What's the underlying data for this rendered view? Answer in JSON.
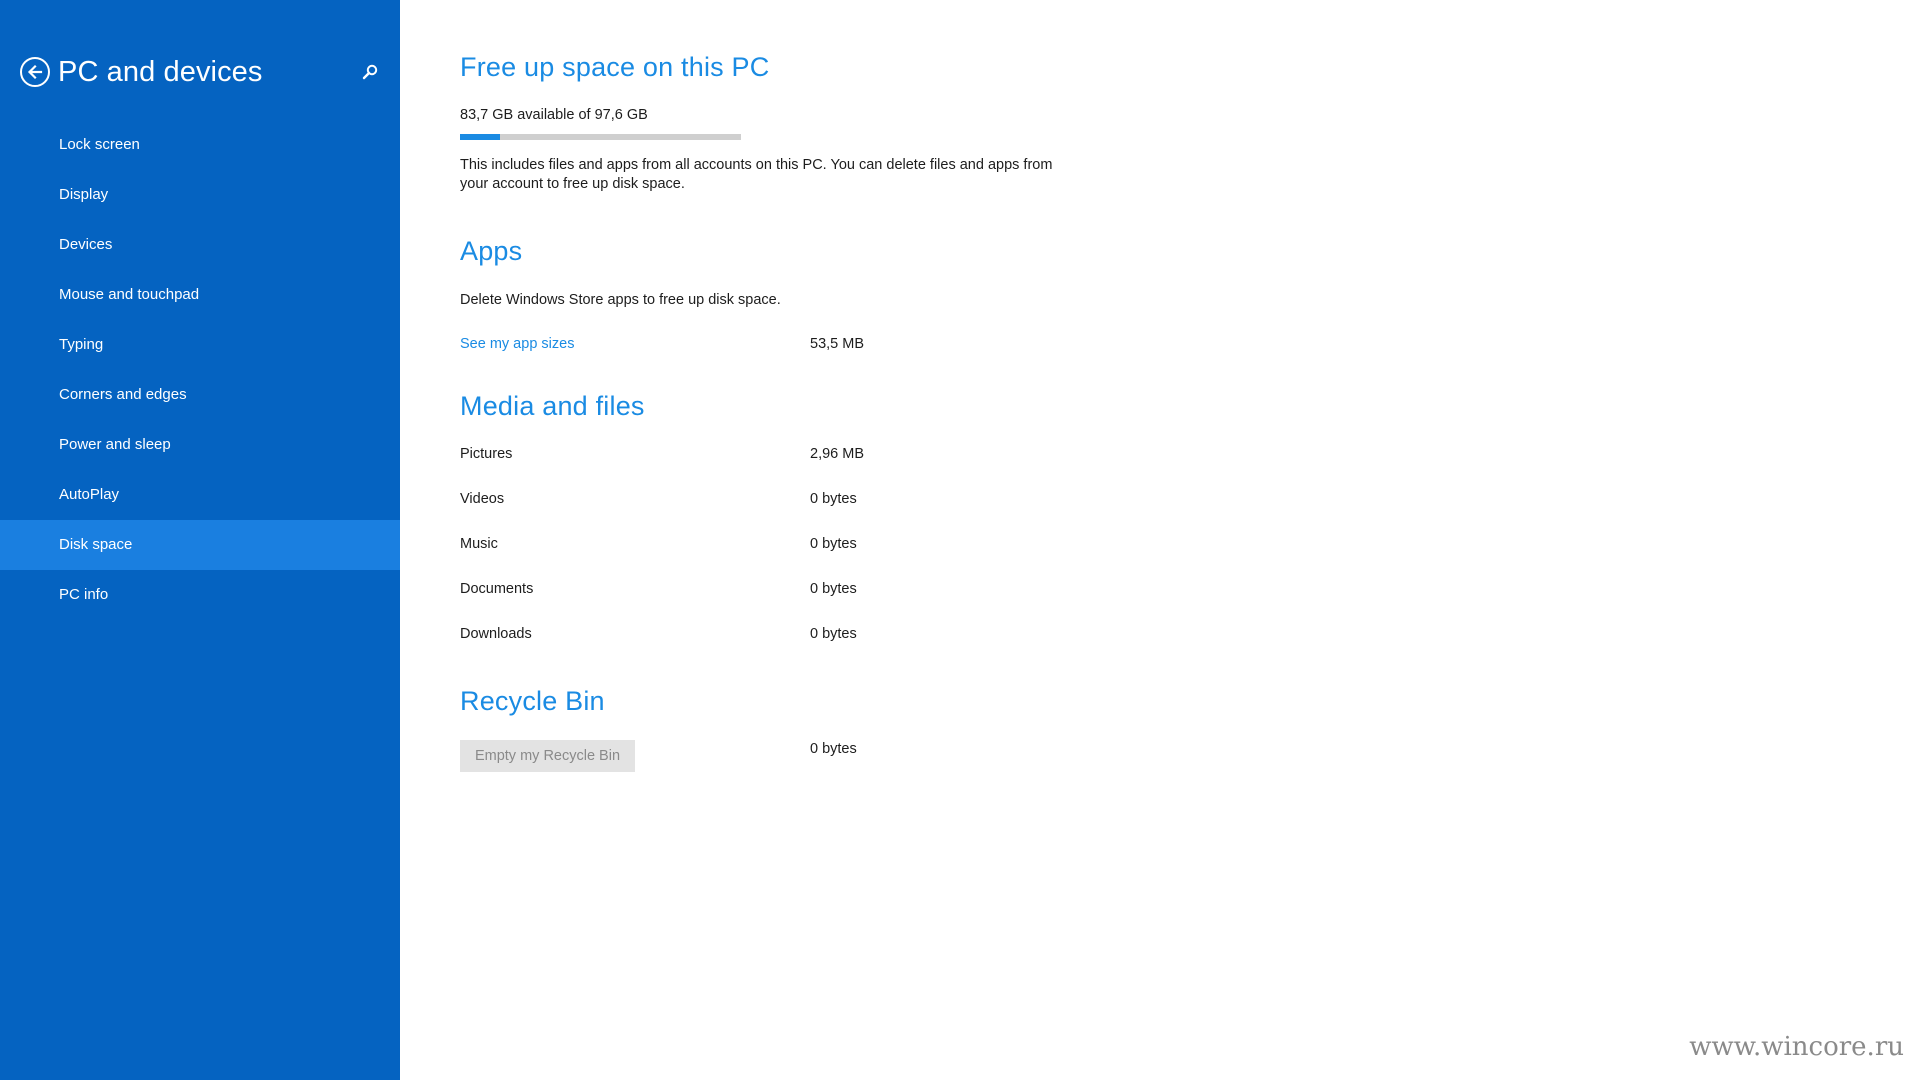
{
  "sidebar": {
    "title": "PC and devices",
    "back_icon": "back-arrow-icon",
    "search_icon": "search-icon",
    "items": [
      {
        "label": "Lock screen"
      },
      {
        "label": "Display"
      },
      {
        "label": "Devices"
      },
      {
        "label": "Mouse and touchpad"
      },
      {
        "label": "Typing"
      },
      {
        "label": "Corners and edges"
      },
      {
        "label": "Power and sleep"
      },
      {
        "label": "AutoPlay"
      },
      {
        "label": "Disk space",
        "selected": true
      },
      {
        "label": "PC info"
      }
    ]
  },
  "main": {
    "free_space": {
      "title": "Free up space on this PC",
      "available": "83,7 GB available of 97,6 GB",
      "used_fraction": 0.142,
      "description": "This includes files and apps from all accounts on this PC. You can delete files and apps from your account to free up disk space."
    },
    "apps": {
      "title": "Apps",
      "description": "Delete Windows Store apps to free up disk space.",
      "link": "See my app sizes",
      "size": "53,5 MB"
    },
    "media": {
      "title": "Media and files",
      "rows": [
        {
          "label": "Pictures",
          "value": "2,96 MB"
        },
        {
          "label": "Videos",
          "value": "0 bytes"
        },
        {
          "label": "Music",
          "value": "0 bytes"
        },
        {
          "label": "Documents",
          "value": "0 bytes"
        },
        {
          "label": "Downloads",
          "value": "0 bytes"
        }
      ]
    },
    "recycle": {
      "title": "Recycle Bin",
      "button": "Empty my Recycle Bin",
      "size": "0 bytes"
    }
  },
  "watermark": "www.wincore.ru",
  "colors": {
    "sidebar_bg": "#0563c1",
    "sidebar_selected": "#1a7fe0",
    "accent": "#1a8be3"
  }
}
